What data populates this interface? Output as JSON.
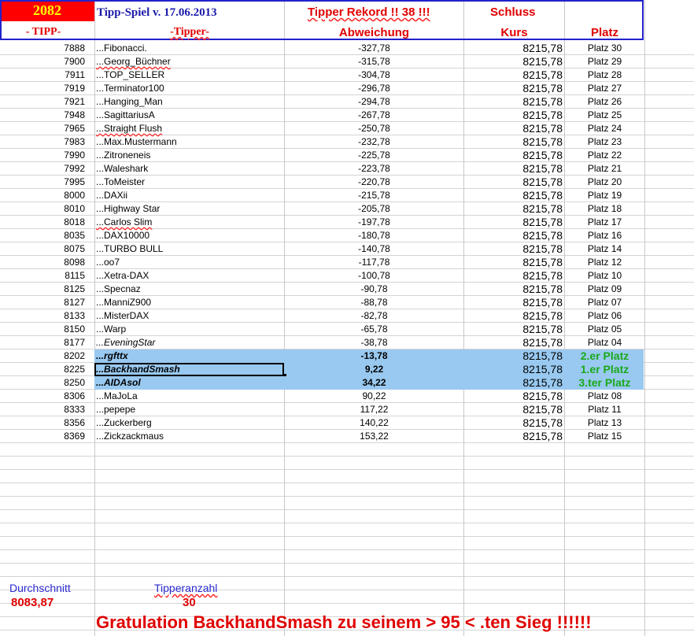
{
  "header": {
    "tipp_count": "2082",
    "title": "Tipp-Spiel v. 17.06.2013",
    "rekord": "Tipper Rekord !!  38  !!!",
    "schluss": "Schluss",
    "col_tipp": "- TIPP-",
    "col_tipper": "-Tipper-",
    "col_abweichung": "Abweichung",
    "col_kurs": "Kurs",
    "col_platz": "Platz"
  },
  "colors": {
    "header_red": "#ff0000",
    "count_yellow": "#ffff00",
    "blue": "#2222cc",
    "highlight": "#99c9f0",
    "green": "#1aaa1a"
  },
  "rows": [
    {
      "tipp": "7888",
      "name": "...Fibonacci.",
      "dev": "-327,78",
      "kurs": "8215,78",
      "platz": "Platz 30"
    },
    {
      "tipp": "7900",
      "name": "...Georg_Büchner",
      "dev": "-315,78",
      "kurs": "8215,78",
      "platz": "Platz 29"
    },
    {
      "tipp": "7911",
      "name": "...TOP_SELLER",
      "dev": "-304,78",
      "kurs": "8215,78",
      "platz": "Platz 28"
    },
    {
      "tipp": "7919",
      "name": "...Terminator100",
      "dev": "-296,78",
      "kurs": "8215,78",
      "platz": "Platz 27"
    },
    {
      "tipp": "7921",
      "name": "...Hanging_Man",
      "dev": "-294,78",
      "kurs": "8215,78",
      "platz": "Platz 26"
    },
    {
      "tipp": "7948",
      "name": "...SagittariusA",
      "dev": "-267,78",
      "kurs": "8215,78",
      "platz": "Platz 25"
    },
    {
      "tipp": "7965",
      "name": "...Straight Flush",
      "dev": "-250,78",
      "kurs": "8215,78",
      "platz": "Platz 24"
    },
    {
      "tipp": "7983",
      "name": "...Max.Mustermann",
      "dev": "-232,78",
      "kurs": "8215,78",
      "platz": "Platz 23"
    },
    {
      "tipp": "7990",
      "name": "...Zitroneneis",
      "dev": "-225,78",
      "kurs": "8215,78",
      "platz": "Platz 22"
    },
    {
      "tipp": "7992",
      "name": "...Waleshark",
      "dev": "-223,78",
      "kurs": "8215,78",
      "platz": "Platz 21"
    },
    {
      "tipp": "7995",
      "name": "...ToMeister",
      "dev": "-220,78",
      "kurs": "8215,78",
      "platz": "Platz 20"
    },
    {
      "tipp": "8000",
      "name": "...DAXii",
      "dev": "-215,78",
      "kurs": "8215,78",
      "platz": "Platz 19"
    },
    {
      "tipp": "8010",
      "name": "...Highway Star",
      "dev": "-205,78",
      "kurs": "8215,78",
      "platz": "Platz 18"
    },
    {
      "tipp": "8018",
      "name": "...Carlos Slim",
      "dev": "-197,78",
      "kurs": "8215,78",
      "platz": "Platz 17"
    },
    {
      "tipp": "8035",
      "name": "...DAX10000",
      "dev": "-180,78",
      "kurs": "8215,78",
      "platz": "Platz 16"
    },
    {
      "tipp": "8075",
      "name": "...TURBO BULL",
      "dev": "-140,78",
      "kurs": "8215,78",
      "platz": "Platz 14"
    },
    {
      "tipp": "8098",
      "name": "...oo7",
      "dev": "-117,78",
      "kurs": "8215,78",
      "platz": "Platz 12"
    },
    {
      "tipp": "8115",
      "name": "...Xetra-DAX",
      "dev": "-100,78",
      "kurs": "8215,78",
      "platz": "Platz 10"
    },
    {
      "tipp": "8125",
      "name": "...Specnaz",
      "dev": "-90,78",
      "kurs": "8215,78",
      "platz": "Platz 09"
    },
    {
      "tipp": "8127",
      "name": "...ManniZ900",
      "dev": "-88,78",
      "kurs": "8215,78",
      "platz": "Platz 07"
    },
    {
      "tipp": "8133",
      "name": "...MisterDAX",
      "dev": "-82,78",
      "kurs": "8215,78",
      "platz": "Platz 06"
    },
    {
      "tipp": "8150",
      "name": "...Warp",
      "dev": "-65,78",
      "kurs": "8215,78",
      "platz": "Platz 05"
    },
    {
      "tipp": "8177",
      "name": "...EveningStar",
      "dev": "-38,78",
      "kurs": "8215,78",
      "platz": "Platz 04"
    },
    {
      "tipp": "8202",
      "name": "...rgfttx",
      "dev": "-13,78",
      "kurs": "8215,78",
      "platz": "2.er Platz"
    },
    {
      "tipp": "8225",
      "name": "...BackhandSmash",
      "dev": "9,22",
      "kurs": "8215,78",
      "platz": "1.er Platz"
    },
    {
      "tipp": "8250",
      "name": "...AIDAsol",
      "dev": "34,22",
      "kurs": "8215,78",
      "platz": "3.ter Platz"
    },
    {
      "tipp": "8306",
      "name": "...MaJoLa",
      "dev": "90,22",
      "kurs": "8215,78",
      "platz": "Platz 08"
    },
    {
      "tipp": "8333",
      "name": "...pepepe",
      "dev": "117,22",
      "kurs": "8215,78",
      "platz": "Platz 11"
    },
    {
      "tipp": "8356",
      "name": "...Zuckerberg",
      "dev": "140,22",
      "kurs": "8215,78",
      "platz": "Platz 13"
    },
    {
      "tipp": "8369",
      "name": "...Zickzackmaus",
      "dev": "153,22",
      "kurs": "8215,78",
      "platz": "Platz 15"
    }
  ],
  "footer": {
    "durchschnitt_label": "Durchschnitt",
    "durchschnitt_value": "8083,87",
    "tipperanzahl_label": "Tipperanzahl",
    "tipperanzahl_value": "30",
    "congrats": "Gratulation BackhandSmash  zu seinem > 95 < .ten Sieg !!!!!!"
  }
}
